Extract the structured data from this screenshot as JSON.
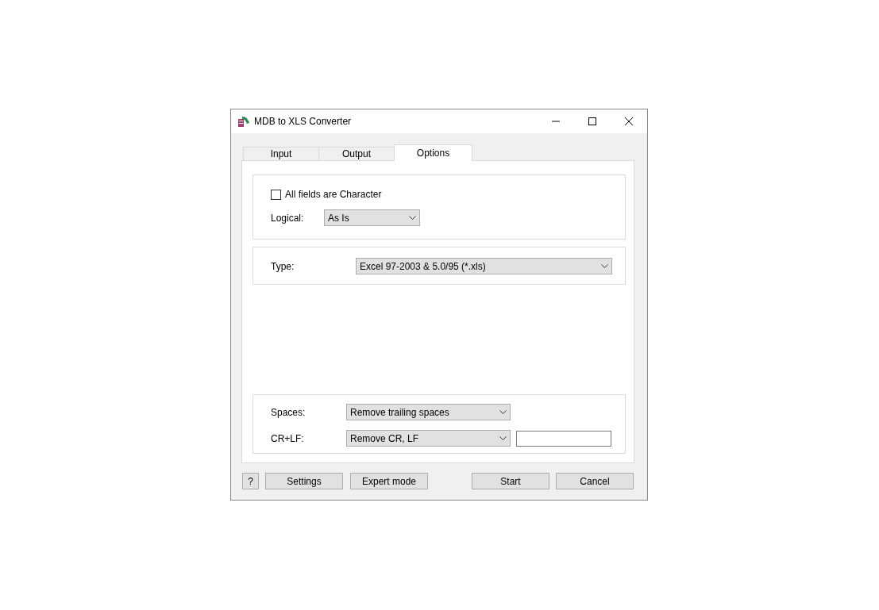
{
  "window": {
    "title": "MDB to XLS Converter"
  },
  "tabs": [
    {
      "label": "Input",
      "selected": false
    },
    {
      "label": "Output",
      "selected": false
    },
    {
      "label": "Options",
      "selected": true
    }
  ],
  "options": {
    "all_fields_character": {
      "label": "All fields are Character",
      "checked": false
    },
    "logical": {
      "label": "Logical:",
      "value": "As Is"
    },
    "type": {
      "label": "Type:",
      "value": "Excel 97-2003 & 5.0/95 (*.xls)"
    },
    "spaces": {
      "label": "Spaces:",
      "value": "Remove trailing spaces"
    },
    "crlf": {
      "label": "CR+LF:",
      "value": "Remove CR, LF"
    }
  },
  "buttons": {
    "help": "?",
    "settings": "Settings",
    "expert_mode": "Expert mode",
    "start": "Start",
    "cancel": "Cancel"
  }
}
